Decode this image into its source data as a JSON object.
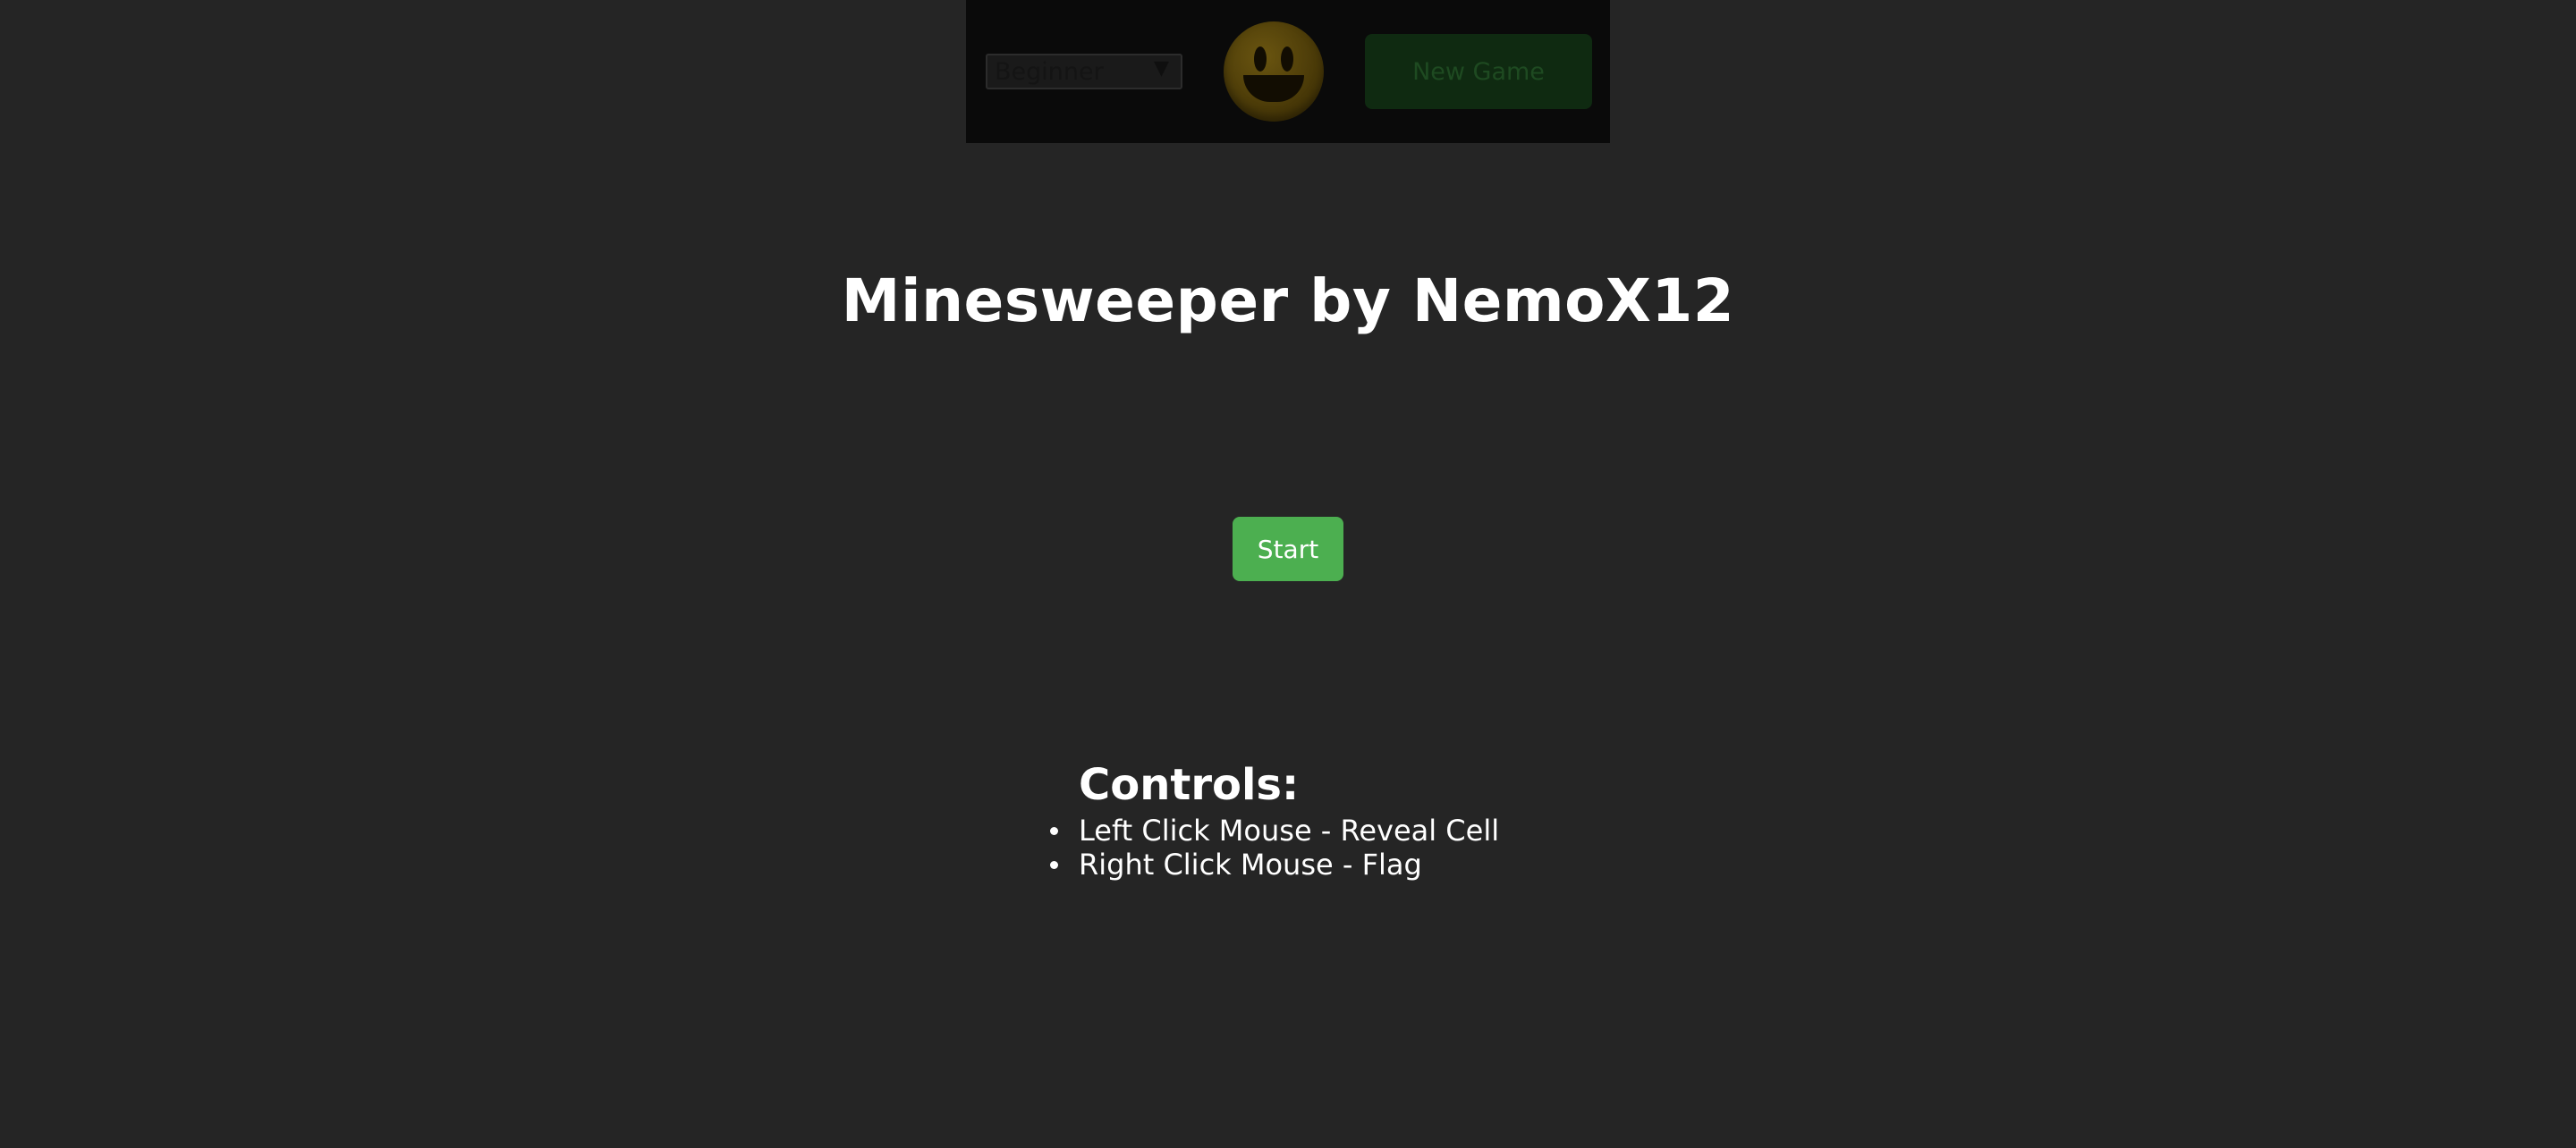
{
  "toolbar": {
    "difficulty_selected": "Beginner",
    "difficulty_options": [
      "Beginner"
    ],
    "smiley_icon": "smiley-face-icon",
    "new_game_label": "New Game"
  },
  "main": {
    "title": "Minesweeper by NemoX12",
    "start_label": "Start"
  },
  "controls": {
    "heading": "Controls:",
    "items": [
      "Left Click Mouse - Reveal Cell",
      "Right Click Mouse - Flag"
    ]
  },
  "colors": {
    "background": "#252525",
    "start_button": "#4caf50",
    "text": "#ffffff"
  }
}
